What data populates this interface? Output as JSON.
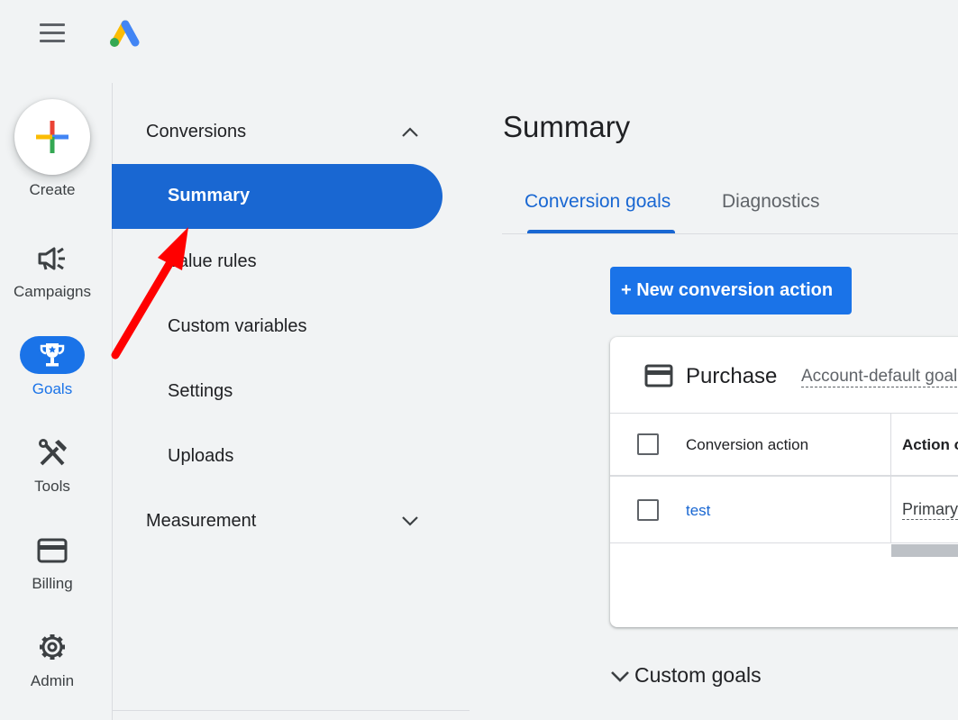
{
  "topbar": {
    "menu_icon": "hamburger-icon",
    "logo_icon": "google-ads-logo-icon"
  },
  "rail": {
    "create_label": "Create",
    "items": [
      {
        "label": "Campaigns",
        "icon": "megaphone-icon"
      },
      {
        "label": "Goals",
        "icon": "trophy-icon",
        "active": true
      },
      {
        "label": "Tools",
        "icon": "tools-icon"
      },
      {
        "label": "Billing",
        "icon": "credit-card-icon"
      },
      {
        "label": "Admin",
        "icon": "gear-icon"
      }
    ]
  },
  "nav": {
    "conversions_header": "Conversions",
    "items": [
      "Summary",
      "Value rules",
      "Custom variables",
      "Settings",
      "Uploads"
    ],
    "active_item": "Summary",
    "measurement_header": "Measurement"
  },
  "main": {
    "title": "Summary",
    "tabs": [
      "Conversion goals",
      "Diagnostics"
    ],
    "active_tab": "Conversion goals",
    "new_action_button": "+ New conversion action",
    "card": {
      "title": "Purchase",
      "subtitle": "Account-default goal",
      "columns": [
        "Conversion action",
        "Action optimization"
      ],
      "rows": [
        {
          "action": "test",
          "optimization": "Primary"
        }
      ]
    },
    "custom_goals_label": "Custom goals"
  },
  "colors": {
    "accent": "#1a73e8",
    "active_nav": "#1967d2",
    "annotation_arrow": "#ff0000"
  }
}
